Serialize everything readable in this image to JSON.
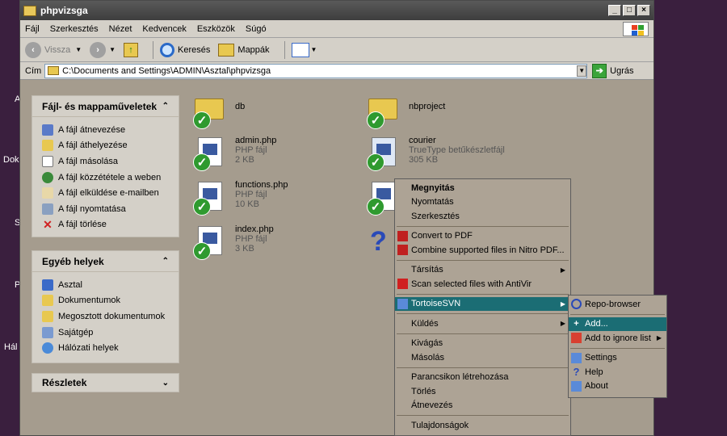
{
  "desktop": {
    "labels": [
      "A",
      "Dok",
      "S",
      "P",
      "Hál"
    ]
  },
  "window": {
    "title": "phpvizsga"
  },
  "menu": [
    "Fájl",
    "Szerkesztés",
    "Nézet",
    "Kedvencek",
    "Eszközök",
    "Súgó"
  ],
  "toolbar": {
    "back": "Vissza",
    "search": "Keresés",
    "folders": "Mappák"
  },
  "address": {
    "label": "Cím",
    "path": "C:\\Documents and Settings\\ADMIN\\Asztal\\phpvizsga",
    "go": "Ugrás"
  },
  "tasks_panel": {
    "title": "Fájl- és mappaműveletek",
    "items": [
      "A fájl átnevezése",
      "A fájl áthelyezése",
      "A fájl másolása",
      "A fájl közzététele a weben",
      "A fájl elküldése e-mailben",
      "A fájl nyomtatása",
      "A fájl törlése"
    ]
  },
  "places_panel": {
    "title": "Egyéb helyek",
    "items": [
      "Asztal",
      "Dokumentumok",
      "Megosztott dokumentumok",
      "Sajátgép",
      "Hálózati helyek"
    ]
  },
  "details_panel": {
    "title": "Részletek"
  },
  "files": [
    {
      "name": "db",
      "type": "",
      "size": ""
    },
    {
      "name": "nbproject",
      "type": "",
      "size": ""
    },
    {
      "name": "admin.php",
      "type": "PHP fájl",
      "size": "2 KB"
    },
    {
      "name": "courier",
      "type": "TrueType betűkészletfájl",
      "size": "305 KB"
    },
    {
      "name": "functions.php",
      "type": "PHP fájl",
      "size": "10 KB"
    },
    {
      "name": "index.php",
      "type": "PHP fájl",
      "size": "3 KB"
    }
  ],
  "context_menu": {
    "items": [
      "Megnyitás",
      "Nyomtatás",
      "Szerkesztés",
      "Convert to PDF",
      "Combine supported files in Nitro PDF...",
      "Társítás",
      "Scan selected files with AntiVir",
      "TortoiseSVN",
      "Küldés",
      "Kivágás",
      "Másolás",
      "Parancsikon létrehozása",
      "Törlés",
      "Átnevezés",
      "Tulajdonságok"
    ]
  },
  "tortoise_submenu": {
    "items": [
      "Repo-browser",
      "Add...",
      "Add to ignore list",
      "Settings",
      "Help",
      "About"
    ]
  },
  "colors": {
    "highlight": "#1b6d74",
    "background": "#a59c8e"
  }
}
